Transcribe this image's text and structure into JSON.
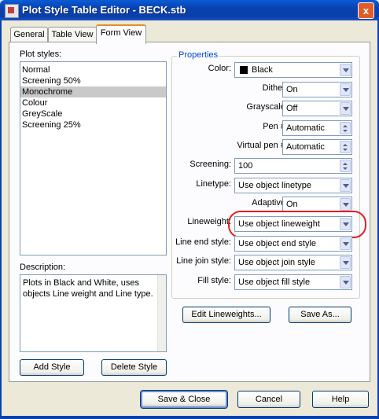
{
  "window": {
    "title": "Plot Style Table Editor - BECK.stb",
    "close_label": "x"
  },
  "tabs": [
    "General",
    "Table View",
    "Form View"
  ],
  "plot_styles": {
    "label": "Plot styles:",
    "items": [
      "Normal",
      "Screening 50%",
      "Monochrome",
      "Colour",
      "GreyScale",
      "Screening 25%"
    ],
    "selected": "Monochrome"
  },
  "description": {
    "label": "Description:",
    "text": "Plots in Black and White, uses objects Line weight and Line type."
  },
  "properties": {
    "group_label": "Properties",
    "color": {
      "label": "Color:",
      "value": "Black",
      "swatch": "#000000"
    },
    "dither": {
      "label": "Dither:",
      "value": "On"
    },
    "grayscale": {
      "label": "Grayscale:",
      "value": "Off"
    },
    "pen": {
      "label": "Pen #:",
      "value": "Automatic"
    },
    "virtual_pen": {
      "label": "Virtual pen #:",
      "value": "Automatic"
    },
    "screening": {
      "label": "Screening:",
      "value": "100"
    },
    "linetype": {
      "label": "Linetype:",
      "value": "Use object linetype"
    },
    "adaptive": {
      "label": "Adaptive:",
      "value": "On"
    },
    "lineweight": {
      "label": "Lineweight:",
      "value": "Use object lineweight"
    },
    "line_end_style": {
      "label": "Line end style:",
      "value": "Use object end style"
    },
    "line_join_style": {
      "label": "Line join style:",
      "value": "Use object join style"
    },
    "fill_style": {
      "label": "Fill style:",
      "value": "Use object fill style"
    }
  },
  "buttons": {
    "edit_lineweights": "Edit Lineweights...",
    "save_as": "Save As...",
    "add_style": "Add Style",
    "delete_style": "Delete Style",
    "save_close": "Save & Close",
    "cancel": "Cancel",
    "help": "Help"
  },
  "colors": {
    "titlebar": "#0842b0",
    "highlight_ring": "#e02020",
    "group_label": "#0046d5"
  }
}
